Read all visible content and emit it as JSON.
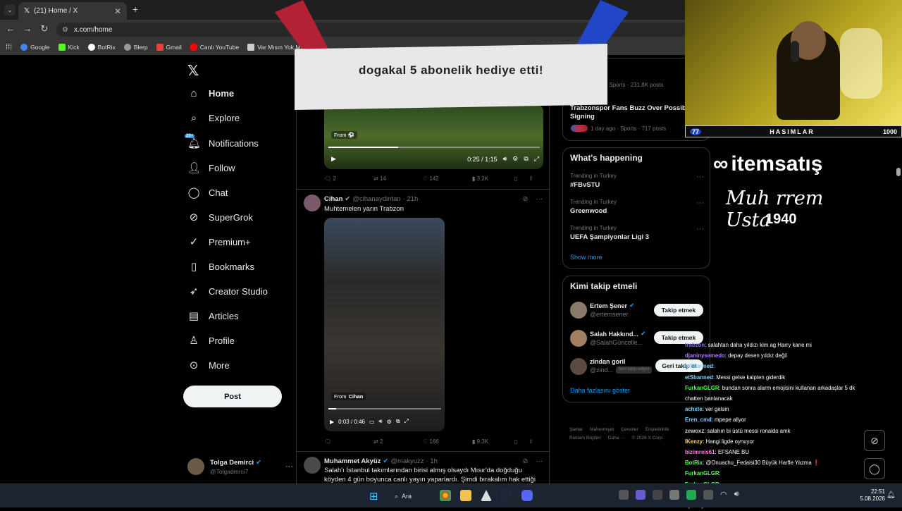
{
  "browser": {
    "tab_title": "(21) Home / X",
    "url": "x.com/home",
    "bookmarks": [
      {
        "label": "Google",
        "color": "#4285f4"
      },
      {
        "label": "Kick",
        "color": "#53fc18"
      },
      {
        "label": "BotRix",
        "color": "#ffffff"
      },
      {
        "label": "Blerp",
        "color": "#cccccc"
      },
      {
        "label": "Gmail",
        "color": "#ea4335"
      },
      {
        "label": "Canlı YouTube",
        "color": "#ff0000"
      },
      {
        "label": "Var Mısın Yok Mu",
        "color": "#cccccc"
      }
    ]
  },
  "sidebar": {
    "items": [
      {
        "label": "Home",
        "icon": "home-icon"
      },
      {
        "label": "Explore",
        "icon": "search-icon"
      },
      {
        "label": "Notifications",
        "icon": "bell-icon",
        "badge": "20+"
      },
      {
        "label": "Follow",
        "icon": "add-user-icon"
      },
      {
        "label": "Chat",
        "icon": "chat-icon"
      },
      {
        "label": "SuperGrok",
        "icon": "grok-icon"
      },
      {
        "label": "Premium+",
        "icon": "verified-icon"
      },
      {
        "label": "Bookmarks",
        "icon": "bookmark-icon"
      },
      {
        "label": "Creator Studio",
        "icon": "rocket-icon"
      },
      {
        "label": "Articles",
        "icon": "article-icon"
      },
      {
        "label": "Profile",
        "icon": "person-icon"
      },
      {
        "label": "More",
        "icon": "more-icon"
      }
    ],
    "post_label": "Post",
    "user_name": "Tolga Demirci",
    "user_handle": "@Tolgadmrci7"
  },
  "timeline": {
    "video1": {
      "source": "From",
      "time": "0:25 / 1:15",
      "progress": 0.33
    },
    "post1_stats": {
      "replies": "2",
      "reposts": "14",
      "likes": "142",
      "views": "3.2K"
    },
    "post2": {
      "name": "Cihan",
      "handle": "@cihanaydintan",
      "time": "· 21h",
      "text": "Muhtemelen yarın Trabzon",
      "video_source": "From",
      "video_source_name": "Cihan",
      "video_time": "0:03 / 0:46",
      "progress": 0.07
    },
    "post2_stats": {
      "replies": "",
      "reposts": "2",
      "likes": "166",
      "views": "9.3K"
    },
    "post3": {
      "name": "Muhammet Akyüz",
      "handle": "@makyuzz",
      "time": "· 1h",
      "text": "Salah'ı İstanbul takımlarından birisi almış olsaydı Mısır'da doğduğu köyden 4 gün boyunca canlı yayın yaparlardı. Şimdi bırakalım hak ettiği kadar"
    }
  },
  "right": {
    "top_trend_meta": "ago · Sports · 231.8K posts",
    "top_trend_title": "Trabzonspor Fans Buzz Over Possible Signing",
    "top_trend_meta2": "1 day ago · Sports · 717 posts",
    "happening_title": "What's happening",
    "trends": [
      {
        "meta": "Trending in Turkey",
        "title": "#FBvSTU"
      },
      {
        "meta": "Trending in Turkey",
        "title": "Greenwood"
      },
      {
        "meta": "Trending in Turkey",
        "title": "UEFA Şampiyonlar Ligi 3"
      }
    ],
    "show_more": "Show more",
    "follow_title": "Kimi takip etmeli",
    "follow": [
      {
        "name": "Ertem Şener",
        "handle": "@ertemsener",
        "button": "Takip etmek"
      },
      {
        "name": "Salah Hakkınd...",
        "handle": "@SalahGüncelle...",
        "button": "Takip etmek"
      },
      {
        "name": "zindan goril",
        "handle": "@zind...",
        "badge": "Seni takip ediyor",
        "button": "Geri takip et"
      }
    ],
    "show_more_follow": "Daha fazlasını göster",
    "footer": [
      "Şartlar",
      "Mahremiyet",
      "Çerezler",
      "Erişilebilirlik",
      "Reklam Bilgileri",
      "Daha ···",
      "© 2026 X Corp."
    ]
  },
  "overlay": {
    "banner_text": "dogakal 5 abonelik hediye etti!",
    "stream_count_left": "77",
    "stream_label": "HASIMLAR",
    "stream_count_right": "1000",
    "sponsor": "itemsatış",
    "sponsor_sign": "Muh rrem Usta",
    "sponsor_num": "1940"
  },
  "chat": [
    {
      "user": "trabzon",
      "color": "#8a6bff",
      "msg": ": salahtan daha yıldızı kim ag Harry kane mi"
    },
    {
      "user": "djaninysemedo",
      "color": "#b07cff",
      "msg": ": depay desen yıldız değil"
    },
    {
      "user": "etSbanned",
      "color": "#7cd6ff",
      "msg": ":"
    },
    {
      "user": "etSbanned",
      "color": "#7cd6ff",
      "msg": ": Messi gelse kalpten giderdik"
    },
    {
      "user": "FurkanGLGR",
      "color": "#55ff55",
      "msg": ": bundan sonra alarm emojisini kullanan arkadaşlar 5 dk"
    },
    {
      "user": "",
      "color": "#ffffff",
      "msg": "chatten banlanacak"
    },
    {
      "user": "achxte",
      "color": "#7cd6ff",
      "msg": ": ver gelsin"
    },
    {
      "user": "Eren_cmd",
      "color": "#7cd6ff",
      "msg": ": mpepe aliyor"
    },
    {
      "user": "zewoxz",
      "color": "#cccccc",
      "msg": ": salahın bi üstü messi ronaldo amk"
    },
    {
      "user": "IKenzy",
      "color": "#ffd35c",
      "msg": ": Hangi ligde oynuyor"
    },
    {
      "user": "bizimreis61",
      "color": "#ff7ce0",
      "msg": ": EFSANE BU"
    },
    {
      "user": "BotRix",
      "color": "#55ff55",
      "msg": ": @Onuachu_Fedaisi30 Büyük Harfle Yazma ❗"
    },
    {
      "user": "FurkanGLGR",
      "color": "#55ff55",
      "msg": ":"
    },
    {
      "user": "FurkanGLGR",
      "color": "#55ff55",
      "msg": ":"
    },
    {
      "user": "AsgariMuhendis",
      "color": "#b07cff",
      "msg": ": selamlar nunez bitti mi arkadaşlar?"
    },
    {
      "user": "djaninysemedo",
      "color": "#b07cff",
      "msg": ":"
    }
  ],
  "taskbar": {
    "search_label": "Ara",
    "time": "22:51",
    "date": "5.08.2026"
  },
  "colors": {
    "x_blue": "#1d9bf0",
    "accent_yellow": "#f2e060"
  }
}
